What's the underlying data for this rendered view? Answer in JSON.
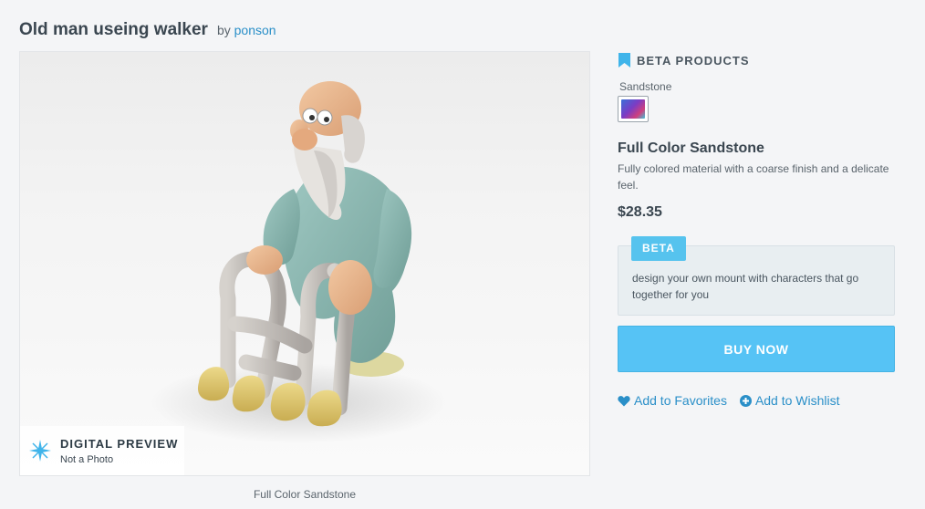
{
  "product": {
    "title": "Old man useing walker",
    "by_prefix": "by",
    "author": "ponson"
  },
  "preview": {
    "badge_title": "DIGITAL PREVIEW",
    "badge_subtitle": "Not a Photo",
    "caption": "Full Color Sandstone",
    "badge_icon": "sparkle-icon"
  },
  "sidebar": {
    "section_title": "BETA PRODUCTS",
    "section_icon": "bookmark-icon",
    "material_label": "Sandstone",
    "material_name": "Full Color Sandstone",
    "material_description": "Fully colored material with a coarse finish and a delicate feel.",
    "price": "$28.35",
    "promo_tag": "BETA",
    "promo_text": "design your own mount with characters that go together for you",
    "buy_label": "BUY NOW",
    "favorites_label": "Add to Favorites",
    "favorites_icon": "heart-icon",
    "wishlist_label": "Add to Wishlist",
    "wishlist_icon": "plus-circle-icon"
  },
  "colors": {
    "accent": "#56c3f5",
    "link": "#2a8fc8"
  }
}
